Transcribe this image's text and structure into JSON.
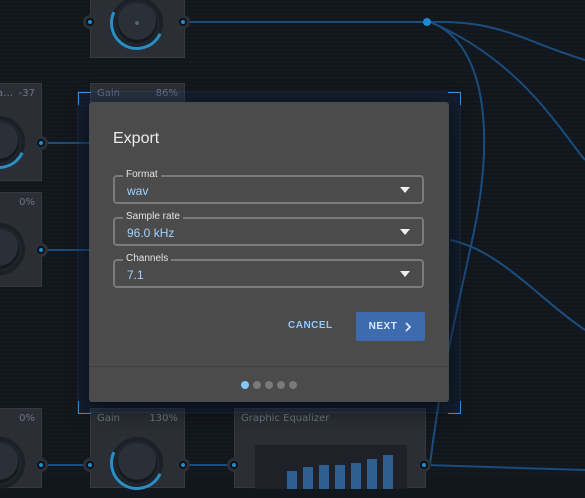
{
  "background_nodes": {
    "gain_top_label": "Gain",
    "gain_top_value": "86%",
    "left_top_label": "a…",
    "left_top_value": "-37",
    "left_mid_value": "0%",
    "left_bottom_value": "0%",
    "gain_bottom_label": "Gain",
    "gain_bottom_value": "130%",
    "eq_label": "Graphic Equalizer"
  },
  "dialog": {
    "title": "Export",
    "fields": [
      {
        "label": "Format",
        "value": "wav"
      },
      {
        "label": "Sample rate",
        "value": "96.0 kHz"
      },
      {
        "label": "Channels",
        "value": "7.1"
      }
    ],
    "cancel_label": "CANCEL",
    "next_label": "NEXT",
    "steps_total": 5,
    "step_current": 1
  },
  "colors": {
    "accent": "#7fc7ff",
    "primary_button": "#3d6bad",
    "wire": "#1f6fb5"
  }
}
